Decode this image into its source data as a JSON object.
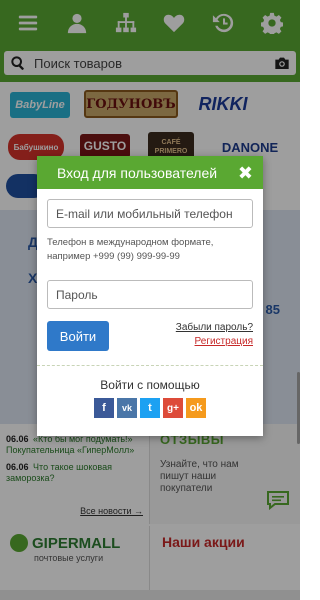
{
  "search": {
    "placeholder": "Поиск товаров"
  },
  "nav": {
    "icons": [
      "menu-icon",
      "user-icon",
      "sitemap-icon",
      "heart-icon",
      "history-icon",
      "gear-icon"
    ]
  },
  "brands": {
    "baby": "BabyLine",
    "godunov": "ГОДУНОВЪ",
    "rikki": "RIKKI",
    "babush": "Бабушкино",
    "gusto": "GUSTO",
    "cafe": "CAFÉ PRIMERO",
    "danone": "DANONE"
  },
  "banner": {
    "line1": "Д",
    "line2": "Х",
    "number": "85"
  },
  "news": {
    "items": [
      {
        "date": "06.06",
        "title": "«Кто бы мог подумать!» Покупательница «ГиперМолл»"
      },
      {
        "date": "06.06",
        "title": "Что такое шоковая заморозка?"
      }
    ],
    "all_label": "Все новости →"
  },
  "reviews": {
    "title": "ОТЗЫВЫ",
    "text": "Узнайте, что нам пишут наши покупатели"
  },
  "gipermall": {
    "logo": "GIPERMALL",
    "sub": "почтовые услуги"
  },
  "actions": {
    "title": "Наши акции"
  },
  "modal": {
    "title": "Вход для пользователей",
    "close": "✖",
    "email_placeholder": "E-mail или мобильный телефон",
    "hint": "Телефон в международном формате, например +999 (99) 999-99-99",
    "password_placeholder": "Пароль",
    "login_button": "Войти",
    "forgot_link": "Забыли пароль?",
    "register_link": "Регистрация",
    "social_title": "Войти с помощью",
    "socials": [
      {
        "icon": "facebook-icon",
        "glyph": "f"
      },
      {
        "icon": "vk-icon",
        "glyph": "vk"
      },
      {
        "icon": "twitter-icon",
        "glyph": "t"
      },
      {
        "icon": "google-plus-icon",
        "glyph": "g+"
      },
      {
        "icon": "odnoklassniki-icon",
        "glyph": "ok"
      }
    ]
  },
  "colors": {
    "brand_green": "#5aa832",
    "login_blue": "#2f79c9",
    "register_red": "#c62828"
  }
}
